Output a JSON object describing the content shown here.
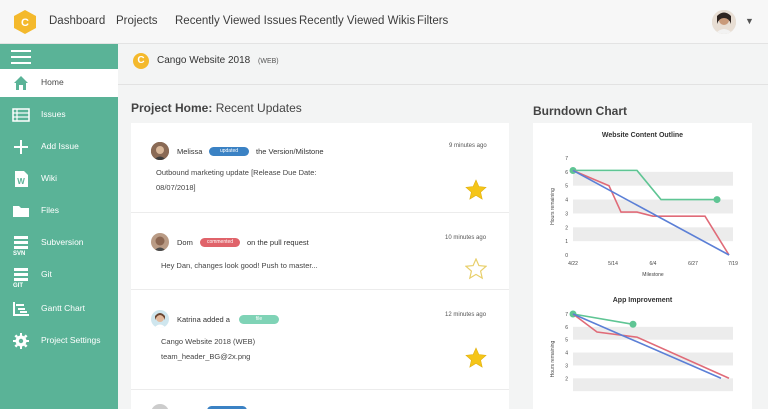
{
  "topnav": {
    "logo_letter": "C",
    "items": [
      "Dashboard",
      "Projects",
      "Recently Viewed Issues",
      "Recently Viewed Wikis",
      "Filters"
    ]
  },
  "sidebar": {
    "items": [
      {
        "label": "Home",
        "icon": "home-icon",
        "active": true
      },
      {
        "label": "Issues",
        "icon": "list-icon"
      },
      {
        "label": "Add Issue",
        "icon": "plus-icon"
      },
      {
        "label": "Wiki",
        "icon": "wiki-document-icon"
      },
      {
        "label": "Files",
        "icon": "folder-icon"
      },
      {
        "label": "Subversion",
        "icon": "svn-icon",
        "sub": "SVN"
      },
      {
        "label": "Git",
        "icon": "git-icon",
        "sub": "GIT"
      },
      {
        "label": "Gantt Chart",
        "icon": "gantt-icon"
      },
      {
        "label": "Project Settings",
        "icon": "gear-icon"
      }
    ]
  },
  "project": {
    "letter": "C",
    "name": "Cango Website 2018",
    "key": "(WEB)"
  },
  "updates_section": {
    "title_bold": "Project Home:",
    "title_rest": " Recent Updates"
  },
  "updates": [
    {
      "user": "Melissa",
      "badge": "updated",
      "badge_color": "#3b82c4",
      "action": "the Version/Milstone",
      "time": "9 minutes ago",
      "body": [
        "Outbound marketing update [Release Due Date:",
        "08/07/2018]"
      ],
      "starred": true
    },
    {
      "user": "Dom",
      "badge": "commented",
      "badge_color": "#e0636a",
      "action": "on the pull request",
      "time": "10 minutes ago",
      "body": [
        "Hey Dan, changes look good!  Push to master..."
      ],
      "starred": false
    },
    {
      "user": "Katrina added a",
      "badge": "file",
      "badge_color": "#7fd3b6",
      "action": "",
      "time": "12 minutes ago",
      "body": [
        "Cango Website 2018 (WEB)",
        "team_header_BG@2x.png"
      ],
      "starred": true
    },
    {
      "user": "",
      "badge": "",
      "badge_color": "#3b82c4",
      "action": "",
      "time": "",
      "body": [],
      "starred": false
    }
  ],
  "burndown": {
    "title": "Burndown Chart"
  },
  "colors": {
    "sidebar": "#5ab397",
    "star_filled": "#f5c518",
    "series_green": "#5fc594",
    "series_red": "#e06b78",
    "series_blue": "#5b7fd6"
  },
  "chart_data": [
    {
      "type": "line",
      "title": "Website Content Outline",
      "xlabel": "Milestone",
      "ylabel": "Hours remaining",
      "categories": [
        "4/22",
        "5/14",
        "6/4",
        "6/27",
        "7/19"
      ],
      "ylim": [
        0,
        7
      ],
      "yticks": [
        0,
        1,
        2,
        3,
        4,
        5,
        6,
        7
      ],
      "series": [
        {
          "color": "#5fc594",
          "x": [
            0,
            1.6,
            2.2,
            3.6
          ],
          "values": [
            6.1,
            6.1,
            4.0,
            4.0
          ],
          "markers": [
            0,
            3
          ]
        },
        {
          "color": "#e06b78",
          "x": [
            0,
            0.9,
            1.2,
            1.6,
            2.0,
            2.6,
            3.3,
            3.9
          ],
          "values": [
            6.1,
            5.0,
            3.1,
            3.1,
            2.8,
            2.8,
            2.8,
            0
          ]
        },
        {
          "color": "#5b7fd6",
          "x": [
            0,
            3.9
          ],
          "values": [
            6.1,
            0
          ]
        }
      ]
    },
    {
      "type": "line",
      "title": "App Improvement",
      "xlabel": "",
      "ylabel": "Hours remaining",
      "categories": [],
      "ylim": [
        0,
        7
      ],
      "yticks": [
        2,
        3,
        4,
        5,
        6,
        7
      ],
      "series": [
        {
          "color": "#5fc594",
          "x": [
            0,
            1.5
          ],
          "values": [
            7.0,
            6.2
          ],
          "markers": [
            0,
            1
          ]
        },
        {
          "color": "#e06b78",
          "x": [
            0,
            0.6,
            1.6,
            3.9
          ],
          "values": [
            7.0,
            5.6,
            5.2,
            2.0
          ]
        },
        {
          "color": "#5b7fd6",
          "x": [
            0,
            3.7
          ],
          "values": [
            7.0,
            2.0
          ]
        }
      ]
    }
  ]
}
